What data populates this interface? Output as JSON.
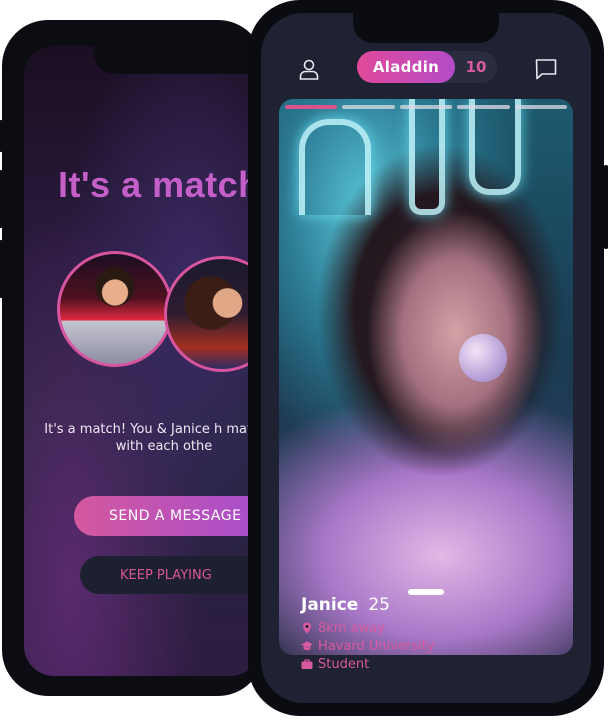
{
  "colors": {
    "accent": "#d9548f",
    "accent_purple": "#b44bc8",
    "screen_bg": "#1e2232",
    "match_title": "#c55fc8"
  },
  "match_screen": {
    "title": "It's a match",
    "message": "It's a match! You & Janice h matched with each othe",
    "send_button": "SEND A MESSAGE",
    "keep_button": "KEEP PLAYING"
  },
  "header": {
    "user_icon": "user-icon",
    "name": "Aladdin",
    "count": "10",
    "chat_icon": "chat-icon"
  },
  "profile": {
    "photo_progress": {
      "total": 5,
      "current": 1
    },
    "name": "Janice",
    "age": "25",
    "distance": "8km away",
    "school": "Havard University",
    "occupation": "Student",
    "icons": {
      "distance": "location-pin-icon",
      "school": "graduation-cap-icon",
      "occupation": "briefcase-icon"
    }
  }
}
